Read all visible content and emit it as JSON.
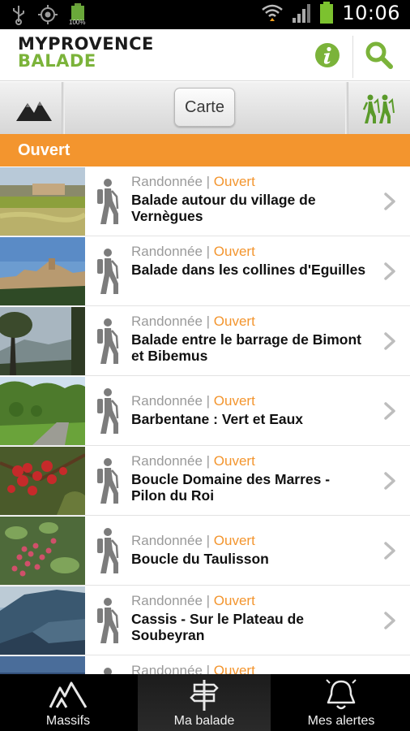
{
  "status_bar": {
    "time": "10:06",
    "battery_small": "100%"
  },
  "header": {
    "logo_line1": "MYPROVENCE",
    "logo_line2": "BALADE"
  },
  "toolbar": {
    "map_button": "Carte"
  },
  "section": {
    "title": "Ouvert"
  },
  "list": [
    {
      "category": "Randonnée",
      "status": "Ouvert",
      "title": "Balade autour du village de Vernègues"
    },
    {
      "category": "Randonnée",
      "status": "Ouvert",
      "title": "Balade dans les collines d'Eguilles"
    },
    {
      "category": "Randonnée",
      "status": "Ouvert",
      "title": "Balade entre le barrage de Bimont et Bibemus"
    },
    {
      "category": "Randonnée",
      "status": "Ouvert",
      "title": "Barbentane : Vert et Eaux"
    },
    {
      "category": "Randonnée",
      "status": "Ouvert",
      "title": "Boucle Domaine des Marres - Pilon du Roi"
    },
    {
      "category": "Randonnée",
      "status": "Ouvert",
      "title": "Boucle du Taulisson"
    },
    {
      "category": "Randonnée",
      "status": "Ouvert",
      "title": "Cassis - Sur le Plateau de Soubeyran"
    },
    {
      "category": "Randonnée",
      "status": "Ouvert",
      "title": ""
    }
  ],
  "bottom_nav": [
    {
      "label": "Massifs",
      "icon": "massifs-icon",
      "active": false
    },
    {
      "label": "Ma balade",
      "icon": "signpost-icon",
      "active": true
    },
    {
      "label": "Mes alertes",
      "icon": "bell-icon",
      "active": false
    }
  ],
  "colors": {
    "accent_orange": "#f3952e",
    "brand_green": "#7bb33a"
  }
}
